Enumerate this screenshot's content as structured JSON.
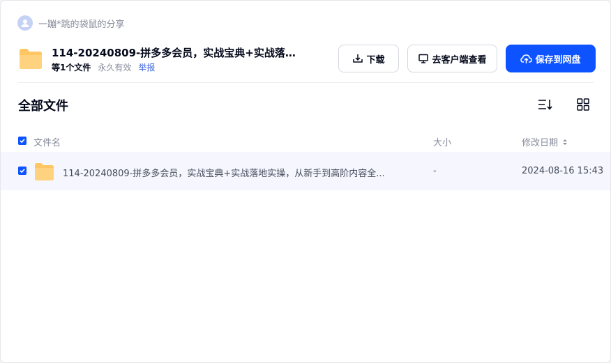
{
  "sharer": {
    "name": "一蹦*跳的袋鼠的分享",
    "avatar_icon": "user-avatar-icon"
  },
  "share": {
    "title": "114-20240809-拼多多会员，实战宝典+实战落地...",
    "file_count": "等1个文件",
    "validity": "永久有效",
    "report": "举报"
  },
  "actions": {
    "download": "下载",
    "open_client": "去客户端查看",
    "save": "保存到网盘"
  },
  "section": {
    "title": "全部文件"
  },
  "table": {
    "headers": {
      "name": "文件名",
      "size": "大小",
      "modified": "修改日期"
    },
    "rows": [
      {
        "name": "114-20240809-拼多多会员，实战宝典+实战落地实操，从新手到高阶内容全...",
        "size": "-",
        "modified": "2024-08-16 15:43",
        "checked": true
      }
    ]
  },
  "colors": {
    "primary": "#0d53ff",
    "folder": "#ffc764",
    "row_highlight": "#f5f6fe"
  }
}
